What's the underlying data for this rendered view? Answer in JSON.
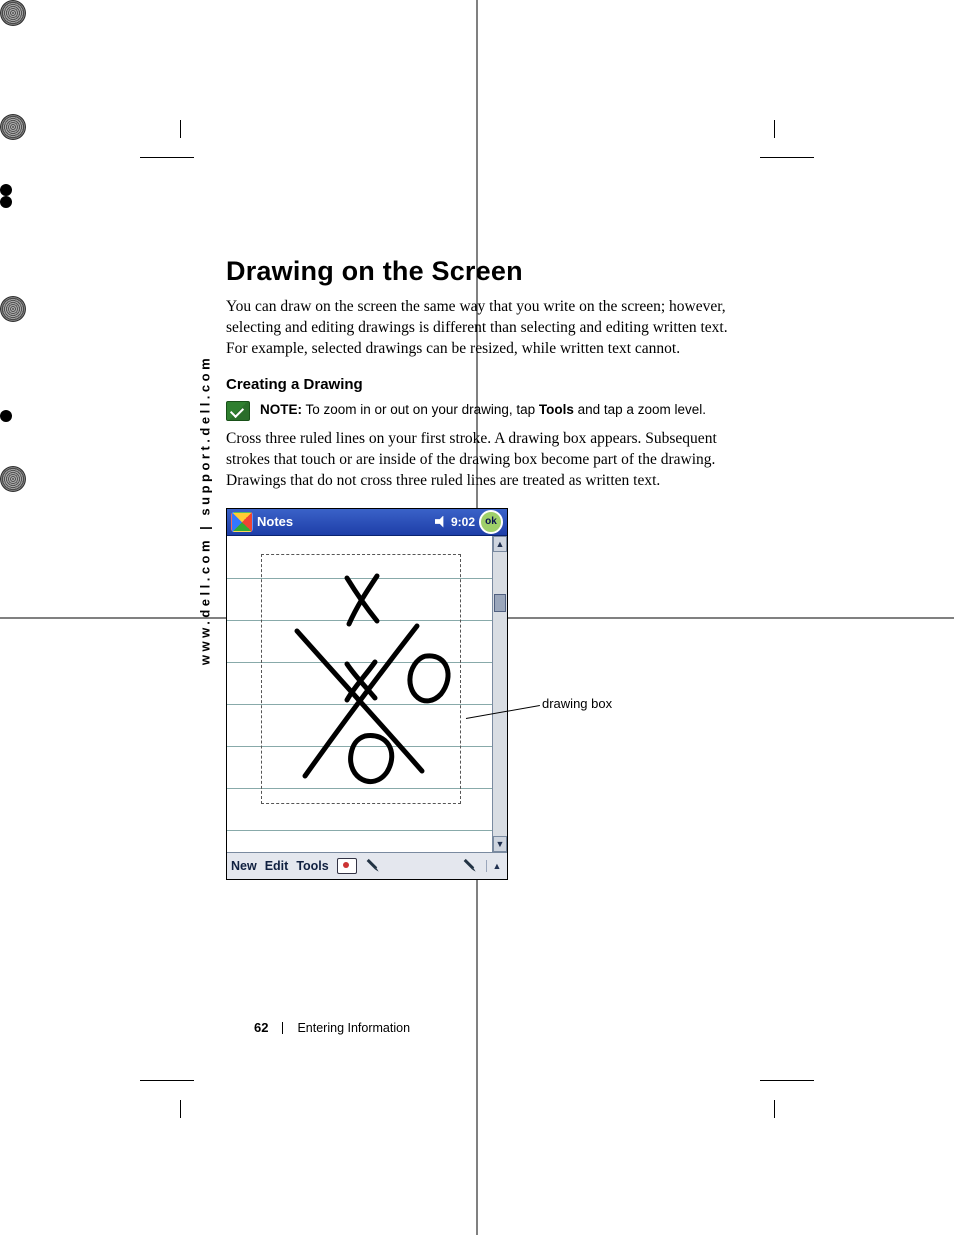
{
  "side_url": "www.dell.com | support.dell.com",
  "heading": "Drawing on the Screen",
  "intro": "You can draw on the screen the same way that you write on the screen; however, selecting and editing drawings is different than selecting and editing written text. For example, selected drawings can be resized, while written text cannot.",
  "subheading": "Creating a Drawing",
  "note": {
    "label": "NOTE:",
    "before_bold": " To zoom in or out on your drawing, tap ",
    "bold": "Tools",
    "after_bold": " and tap a zoom level."
  },
  "body": "Cross three ruled lines on your first stroke. A drawing box appears. Subsequent strokes that touch or are inside of the drawing box become part of the drawing. Drawings that do not cross three ruled lines are treated as written text.",
  "callout": "drawing box",
  "pda": {
    "title": "Notes",
    "time": "9:02",
    "ok": "ok",
    "menu": {
      "new": "New",
      "edit": "Edit",
      "tools": "Tools"
    }
  },
  "footer": {
    "page": "62",
    "section": "Entering Information"
  }
}
